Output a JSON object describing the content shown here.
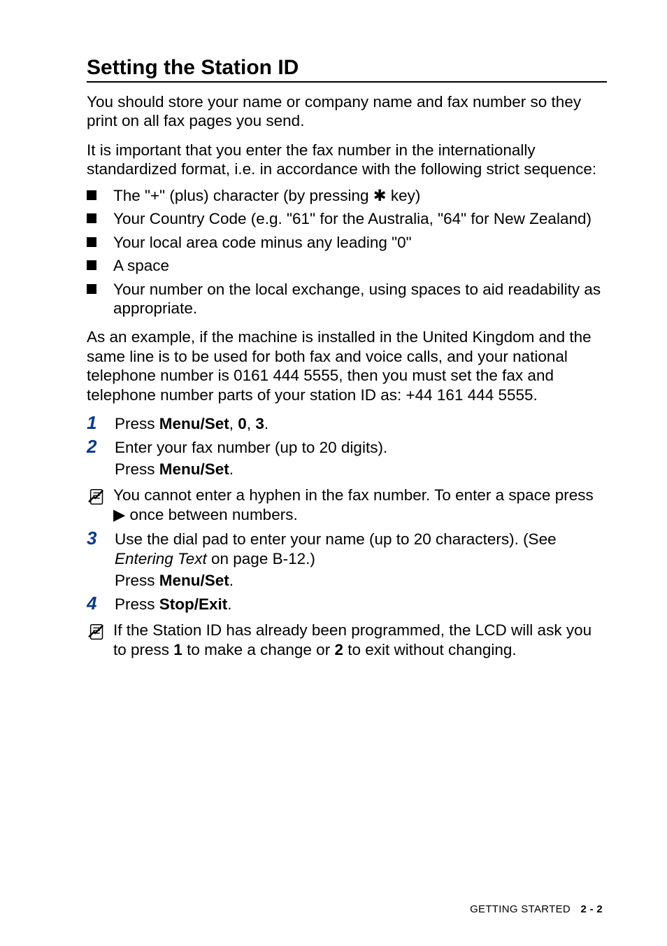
{
  "heading": "Setting the Station ID",
  "intro1": "You should store your name or company name and fax number so they print on all fax pages you send.",
  "intro2": "It is important that you enter the fax number in the internationally standardized format, i.e. in accordance with the following strict sequence:",
  "bullets": [
    "The \"+\" (plus) character (by pressing  ✱  key)",
    "Your Country Code (e.g. \"61\" for the Australia, \"64\" for New Zealand)",
    "Your local area code minus any leading \"0\"",
    "A space",
    "Your number on the local exchange, using spaces to aid readability as appropriate."
  ],
  "example": "As an example, if the machine is installed in the United Kingdom and the same line is to be used for both fax and voice calls, and your national telephone number is 0161 444 5555, then you must set the fax and telephone number parts of your station ID as: +44 161 444 5555.",
  "steps": {
    "s1": {
      "num": "1",
      "pre": "Press ",
      "b1": "Menu/Set",
      "mid1": ", ",
      "b2": "0",
      "mid2": ", ",
      "b3": "3",
      "post": "."
    },
    "s2": {
      "num": "2",
      "line1": "Enter your fax number (up to 20 digits).",
      "line2pre": "Press ",
      "line2b": "Menu/Set",
      "line2post": "."
    },
    "s3": {
      "num": "3",
      "line1a": "Use the dial pad to enter your name (up to 20 characters). (See ",
      "line1i": "Entering Text",
      "line1b": " on page B-12.)",
      "line2pre": "Press ",
      "line2b": "Menu/Set",
      "line2post": "."
    },
    "s4": {
      "num": "4",
      "pre": "Press ",
      "b1": "Stop/Exit",
      "post": "."
    }
  },
  "note1": "You cannot enter a hyphen in the fax number. To enter a space press  ▶  once between numbers.",
  "note2": {
    "pre": "If the Station ID has already been programmed, the LCD will ask you to press ",
    "b1": "1",
    "mid": " to make a change or ",
    "b2": "2",
    "post": " to exit without changing."
  },
  "footer": {
    "label": "GETTING STARTED",
    "page": "2 - 2"
  }
}
